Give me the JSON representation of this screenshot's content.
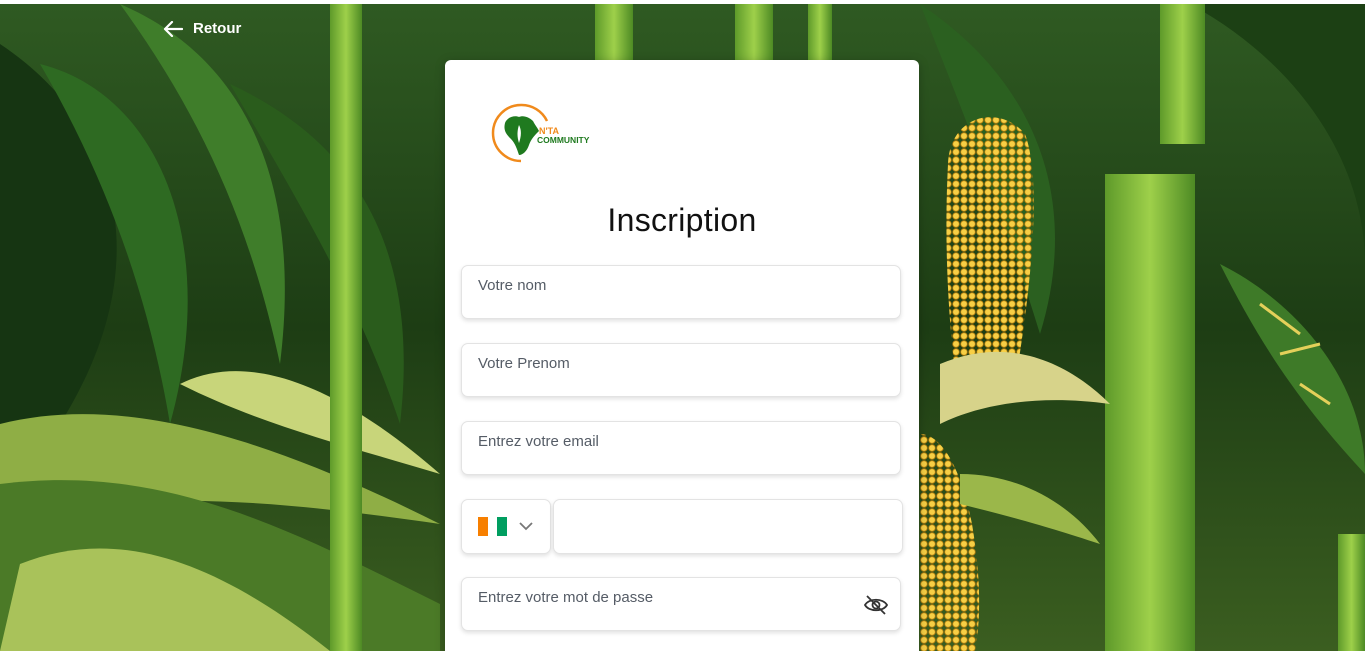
{
  "nav": {
    "back_label": "Retour"
  },
  "brand": {
    "logo_text_top": "N'TA",
    "logo_text_bottom": "COMMUNITY",
    "colors": {
      "orange": "#f08a1c",
      "green": "#1f7a1f"
    }
  },
  "form": {
    "title": "Inscription",
    "nom_placeholder": "Votre nom",
    "prenom_placeholder": "Votre Prenom",
    "email_placeholder": "Entrez votre email",
    "phone": {
      "country_flag": "flag-civ-icon",
      "flag_colors": [
        "#f77f00",
        "#ffffff",
        "#009e60"
      ],
      "value": ""
    },
    "password_placeholder": "Entrez votre mot de passe"
  }
}
